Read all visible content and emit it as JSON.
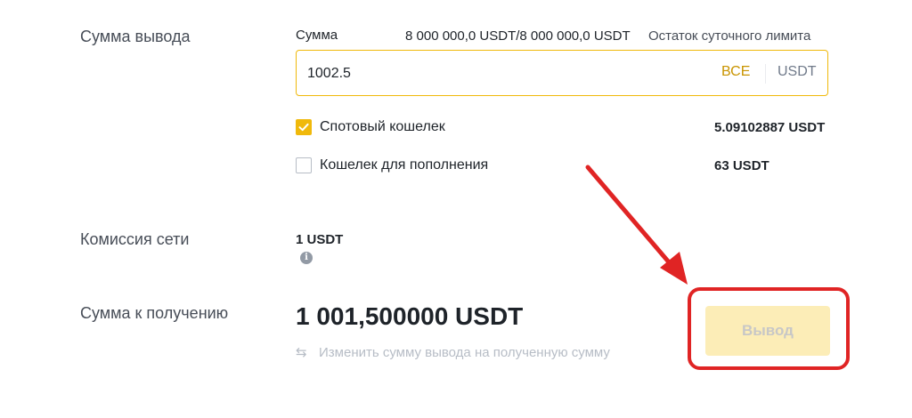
{
  "withdraw": {
    "label": "Сумма вывода",
    "amount_header": "Сумма",
    "limit_value": "8 000 000,0 USDT/8 000 000,0 USDT",
    "limit_label": "Остаток суточного лимита",
    "amount_value": "1002.5",
    "max_label": "ВСЕ",
    "currency": "USDT"
  },
  "wallets": [
    {
      "label": "Спотовый кошелек",
      "balance": "5.09102887 USDT",
      "checked": true
    },
    {
      "label": "Кошелек для пополнения",
      "balance": "63 USDT",
      "checked": false
    }
  ],
  "fee": {
    "label": "Комиссия сети",
    "value": "1 USDT",
    "info_icon": "i"
  },
  "receive": {
    "label": "Сумма к получению",
    "value": "1 001,500000 USDT",
    "switch_icon": "⇆",
    "switch_label": "Изменить сумму вывода на полученную сумму"
  },
  "submit": {
    "label": "Вывод",
    "state": "disabled"
  },
  "colors": {
    "accent": "#f0b90b",
    "accent_text": "#c99400",
    "annotation": "#e02424",
    "button_disabled_bg": "#fcedb7"
  }
}
